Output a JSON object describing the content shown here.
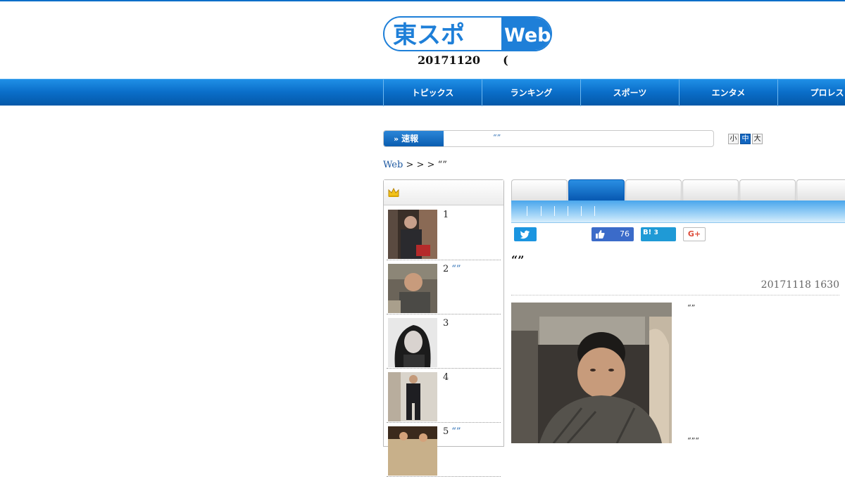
{
  "site": {
    "logo_text": "東スポ",
    "logo_web": "Web",
    "date": "20171120",
    "date_suffix": "("
  },
  "nav": {
    "items": [
      "トピックス",
      "ランキング",
      "スポーツ",
      "エンタメ",
      "プロレス"
    ]
  },
  "breaking": {
    "label": "速報",
    "ticker": "“”"
  },
  "font_size": {
    "small": "小",
    "medium": "中",
    "large": "大",
    "active": "medium"
  },
  "breadcrumb": {
    "home": "Web",
    "sep1": " > ",
    "sep2": " > ",
    "sep3": " > ",
    "current": "“”"
  },
  "ranking": {
    "items": [
      {
        "rank": "1",
        "title": ""
      },
      {
        "rank": "2",
        "title": "“”"
      },
      {
        "rank": "3",
        "title": ""
      },
      {
        "rank": "4",
        "title": ""
      },
      {
        "rank": "5",
        "title": "“”"
      }
    ]
  },
  "article": {
    "fb_count": "76",
    "hatena_label": "B!",
    "hatena_count": "3",
    "gplus_label": "G+",
    "title": "“”",
    "date": "20171118 1630",
    "text1": "“”",
    "text2": "“”“"
  },
  "colors": {
    "accent": "#0a6dc8",
    "link": "#2a6db3"
  }
}
